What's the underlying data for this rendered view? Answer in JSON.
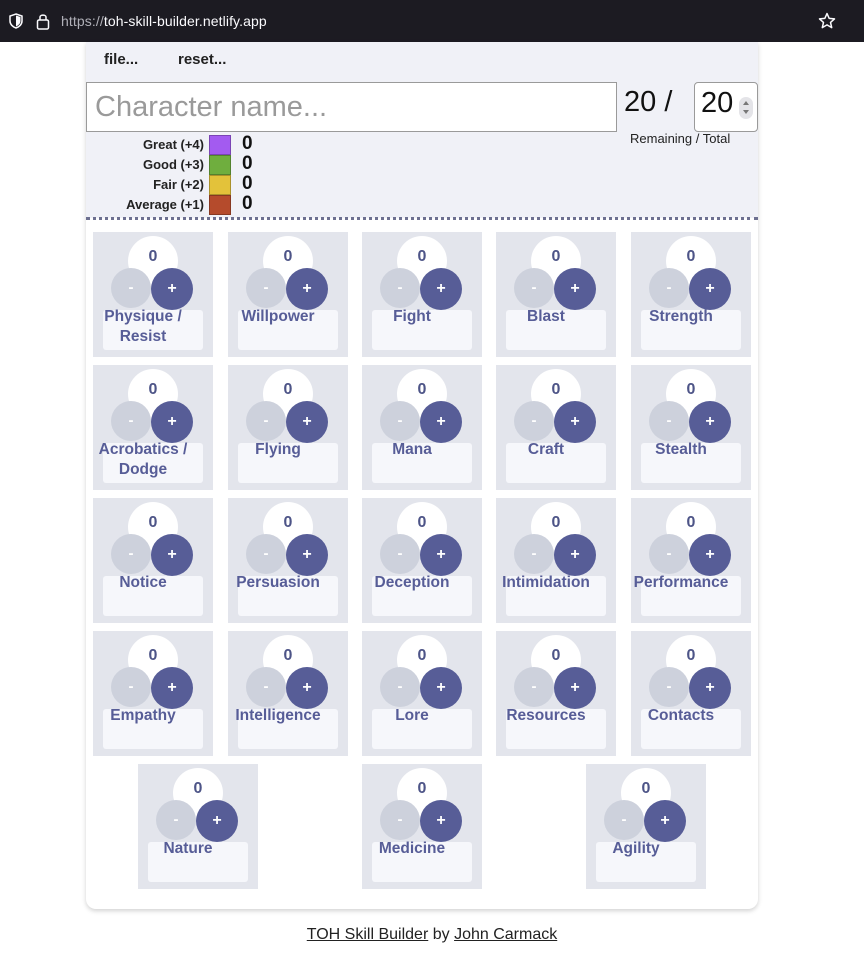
{
  "browser": {
    "url_scheme": "https://",
    "url_host": "toh-skill-builder.netlify.app"
  },
  "menu": {
    "file_label": "file...",
    "reset_label": "reset..."
  },
  "character": {
    "name_placeholder": "Character name...",
    "name_value": ""
  },
  "points": {
    "remaining": "20 /",
    "total": "20",
    "caption": "Remaining / Total"
  },
  "legend": [
    {
      "label": "Great (+4)",
      "count": "0",
      "color": "#a35bf0"
    },
    {
      "label": "Good (+3)",
      "count": "0",
      "color": "#6fae3e"
    },
    {
      "label": "Fair (+2)",
      "count": "0",
      "color": "#e3c23a"
    },
    {
      "label": "Average (+1)",
      "count": "0",
      "color": "#b54b2c"
    }
  ],
  "skills": [
    {
      "name": "Physique / Resist",
      "value": "0"
    },
    {
      "name": "Willpower",
      "value": "0"
    },
    {
      "name": "Fight",
      "value": "0"
    },
    {
      "name": "Blast",
      "value": "0"
    },
    {
      "name": "Strength",
      "value": "0"
    },
    {
      "name": "Acrobatics / Dodge",
      "value": "0"
    },
    {
      "name": "Flying",
      "value": "0"
    },
    {
      "name": "Mana",
      "value": "0"
    },
    {
      "name": "Craft",
      "value": "0"
    },
    {
      "name": "Stealth",
      "value": "0"
    },
    {
      "name": "Notice",
      "value": "0"
    },
    {
      "name": "Persuasion",
      "value": "0"
    },
    {
      "name": "Deception",
      "value": "0"
    },
    {
      "name": "Intimidation",
      "value": "0"
    },
    {
      "name": "Performance",
      "value": "0"
    },
    {
      "name": "Empathy",
      "value": "0"
    },
    {
      "name": "Intelligence",
      "value": "0"
    },
    {
      "name": "Lore",
      "value": "0"
    },
    {
      "name": "Resources",
      "value": "0"
    },
    {
      "name": "Contacts",
      "value": "0"
    },
    {
      "name": "Nature",
      "value": "0"
    },
    {
      "name": "Medicine",
      "value": "0"
    },
    {
      "name": "Agility",
      "value": "0"
    }
  ],
  "buttons": {
    "minus": "-",
    "plus": "+"
  },
  "footer": {
    "app_link": "TOH Skill Builder",
    "by": "by",
    "author_link": "John Carmack"
  },
  "colors": {
    "accent": "#575d97",
    "tile_bg": "#e3e5ec",
    "minus_bg": "#cdd1dc"
  }
}
